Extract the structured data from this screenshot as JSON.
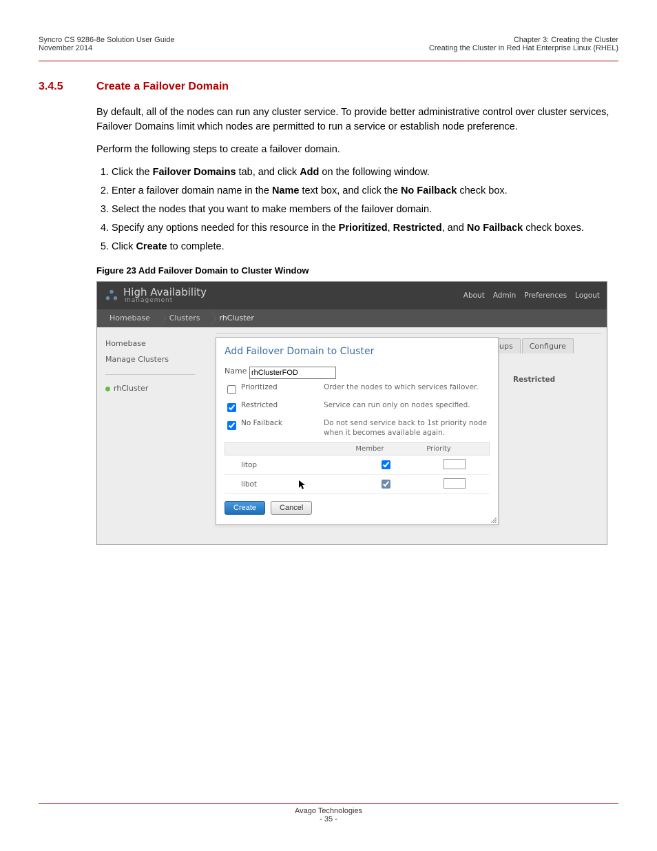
{
  "header": {
    "left_line1": "Syncro CS 9286-8e Solution User Guide",
    "left_line2": "November 2014",
    "right_line1": "Chapter 3: Creating the Cluster",
    "right_line2": "Creating the Cluster in Red Hat Enterprise Linux (RHEL)"
  },
  "section": {
    "number": "3.4.5",
    "title": "Create a Failover Domain"
  },
  "paragraphs": {
    "p1": "By default, all of the nodes can run any cluster service. To provide better administrative control over cluster services, Failover Domains limit which nodes are permitted to run a service or establish node preference.",
    "p2": "Perform the following steps to create a failover domain."
  },
  "steps": {
    "s1a": "Click the ",
    "s1b": "Failover Domains",
    "s1c": " tab, and click ",
    "s1d": "Add",
    "s1e": " on the following window.",
    "s2a": "Enter a failover domain name in the ",
    "s2b": "Name",
    "s2c": " text box, and click the ",
    "s2d": "No Failback",
    "s2e": " check box.",
    "s3": "Select the nodes that you want to make members of the failover domain.",
    "s4a": "Specify any options needed for this resource in the ",
    "s4b": "Prioritized",
    "s4c": ", ",
    "s4d": "Restricted",
    "s4e": ", and ",
    "s4f": "No Failback",
    "s4g": " check boxes.",
    "s5a": "Click ",
    "s5b": "Create",
    "s5c": " to complete."
  },
  "figure_caption": "Figure 23  Add Failover Domain to Cluster Window",
  "screenshot": {
    "logo_line1": "High Availability",
    "logo_line2": "management",
    "toplinks": {
      "about": "About",
      "admin": "Admin",
      "prefs": "Preferences",
      "logout": "Logout"
    },
    "breadcrumb": {
      "b1": "Homebase",
      "b2": "Clusters",
      "b3": "rhCluster"
    },
    "sidebar": {
      "item1": "Homebase",
      "item2": "Manage Clusters",
      "cluster": "rhCluster"
    },
    "tabs": {
      "groups": "roups",
      "configure": "Configure"
    },
    "column_head": "Restricted",
    "dialog": {
      "title": "Add Failover Domain to Cluster",
      "name_label": "Name",
      "name_value": "rhClusterFOD",
      "opts": {
        "prioritized": {
          "label": "Prioritized",
          "desc": "Order the nodes to which services failover."
        },
        "restricted": {
          "label": "Restricted",
          "desc": "Service can run only on nodes specified."
        },
        "nofailback": {
          "label": "No Failback",
          "desc": "Do not send service back to 1st priority node when it becomes available again."
        }
      },
      "table_head": {
        "member": "Member",
        "priority": "Priority"
      },
      "members": {
        "m1": "litop",
        "m2": "libot"
      },
      "create": "Create",
      "cancel": "Cancel"
    }
  },
  "footer": {
    "company": "Avago Technologies",
    "page": "- 35 -"
  }
}
